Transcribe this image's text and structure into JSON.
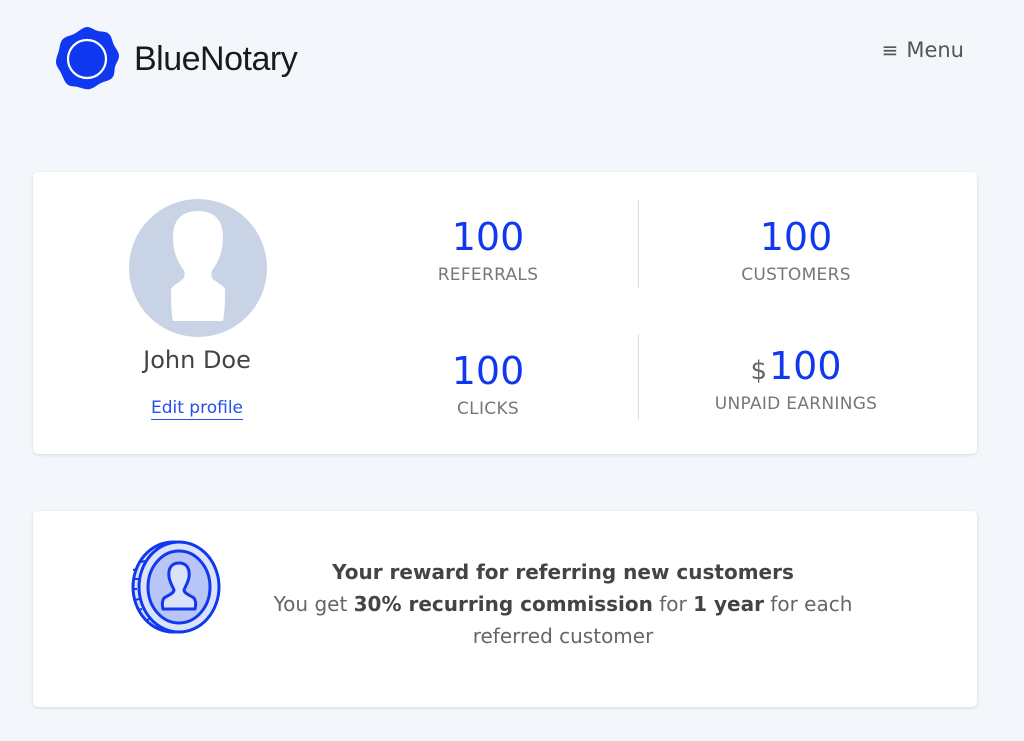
{
  "brand": {
    "name": "BlueNotary",
    "color": "#1038f0"
  },
  "nav": {
    "menu_label": "Menu",
    "menu_icon": "hamburger-icon"
  },
  "profile": {
    "name": "John Doe",
    "edit_label": "Edit profile",
    "avatar_icon": "user-silhouette-icon"
  },
  "stats": {
    "referrals": {
      "value": "100",
      "label": "REFERRALS"
    },
    "customers": {
      "value": "100",
      "label": "CUSTOMERS"
    },
    "clicks": {
      "value": "100",
      "label": "CLICKS"
    },
    "unpaid": {
      "currency": "$",
      "value": "100",
      "label": "UNPAID EARNINGS"
    }
  },
  "reward": {
    "icon": "coin-user-icon",
    "title": "Your reward for referring new customers",
    "text_1": "You get ",
    "highlight_1": "30% recurring commission",
    "text_2": " for ",
    "highlight_2": "1 year",
    "text_3": " for each referred customer"
  },
  "colors": {
    "accent": "#1038f0",
    "background": "#f3f6fa",
    "avatar_bg": "#c9d3e6",
    "link": "#2450e8"
  }
}
